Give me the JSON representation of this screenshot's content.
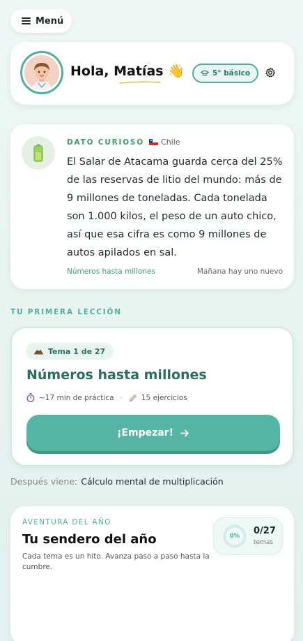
{
  "menu": {
    "label": "Menú",
    "icon": "hamburger-icon"
  },
  "header": {
    "greeting": "Hola, Matías",
    "wave_emoji": "👋",
    "grade_label": "5° básico",
    "grade_icon": "graduation-cap-icon",
    "settings_icon": "gear-icon"
  },
  "fact": {
    "kicker": "DATO CURIOSO",
    "country": "Chile",
    "icon": "battery-icon",
    "text": "El Salar de Atacama guarda cerca del 25% de las reservas de litio del mundo: más de 9 millones de toneladas. Cada tonelada son 1.000 kilos, el peso de un auto chico, así que esa cifra es como 9 millones de autos apilados en sal.",
    "topic_link": "Números hasta millones",
    "next_note": "Mañana hay uno nuevo"
  },
  "lesson": {
    "section_label": "TU PRIMERA LECCIÓN",
    "topic_pill": "Tema 1 de 27",
    "title": "Números hasta millones",
    "duration": "~17 min de práctica",
    "exercises": "15 ejercicios",
    "start_label": "¡Empezar!",
    "next_prefix": "Después viene:",
    "next_topic": "Cálculo mental de multiplicación"
  },
  "year": {
    "kicker": "AVENTURA DEL AÑO",
    "title": "Tu sendero del año",
    "description": "Cada tema es un hito. Avanza paso a paso hasta la cumbre.",
    "progress_pct_label": "0%",
    "progress_fraction": 0,
    "progress_count": "0/27",
    "progress_unit": "temas"
  },
  "colors": {
    "accent": "#4fae9e",
    "button": "#55b4a3",
    "fact_green": "#3aa16c",
    "title_teal": "#2a6e61"
  }
}
